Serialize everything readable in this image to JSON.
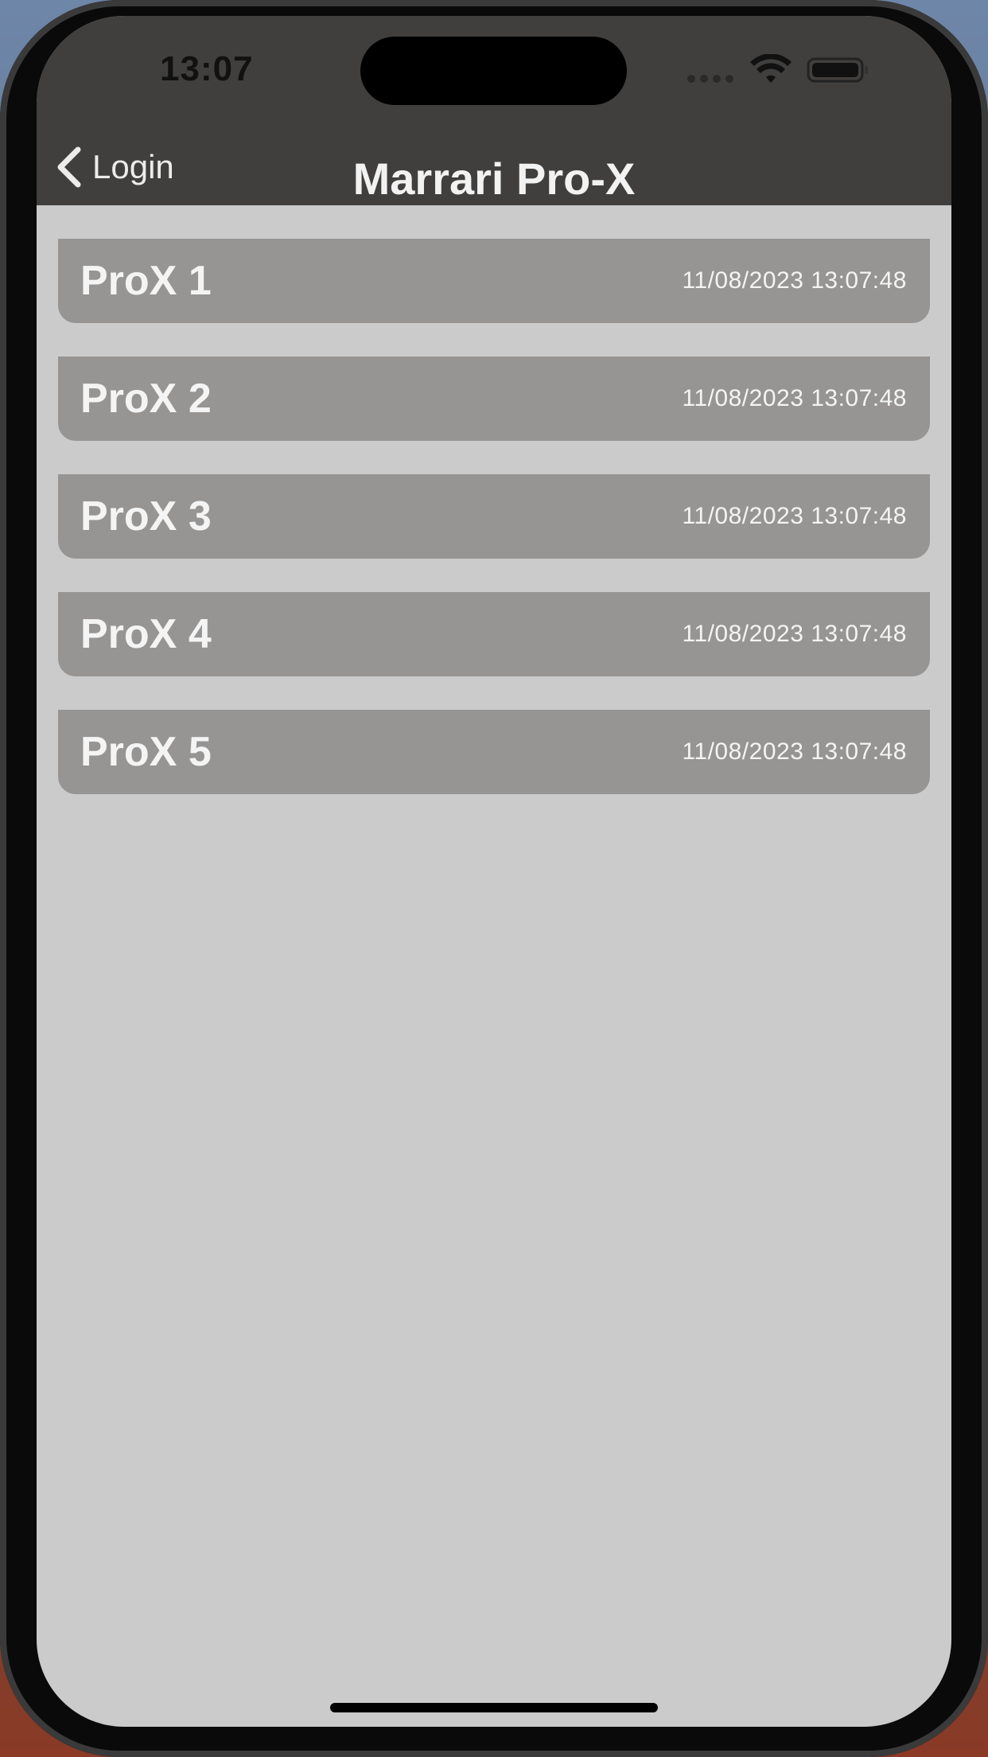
{
  "status_bar": {
    "time": "13:07"
  },
  "nav": {
    "back_label": "Login",
    "title": "Marrari Pro-X"
  },
  "devices": [
    {
      "name": "ProX 1",
      "timestamp": "11/08/2023 13:07:48"
    },
    {
      "name": "ProX 2",
      "timestamp": "11/08/2023 13:07:48"
    },
    {
      "name": "ProX 3",
      "timestamp": "11/08/2023 13:07:48"
    },
    {
      "name": "ProX 4",
      "timestamp": "11/08/2023 13:07:48"
    },
    {
      "name": "ProX 5",
      "timestamp": "11/08/2023 13:07:48"
    }
  ],
  "colors": {
    "nav_background": "#403f3e",
    "screen_background": "#cbcbcb",
    "item_background": "#969594",
    "text_light": "#f4f4f4"
  },
  "icons": {
    "back": "chevron-left-icon",
    "wifi": "wifi-icon",
    "battery": "battery-icon",
    "signal": "signal-icon"
  }
}
